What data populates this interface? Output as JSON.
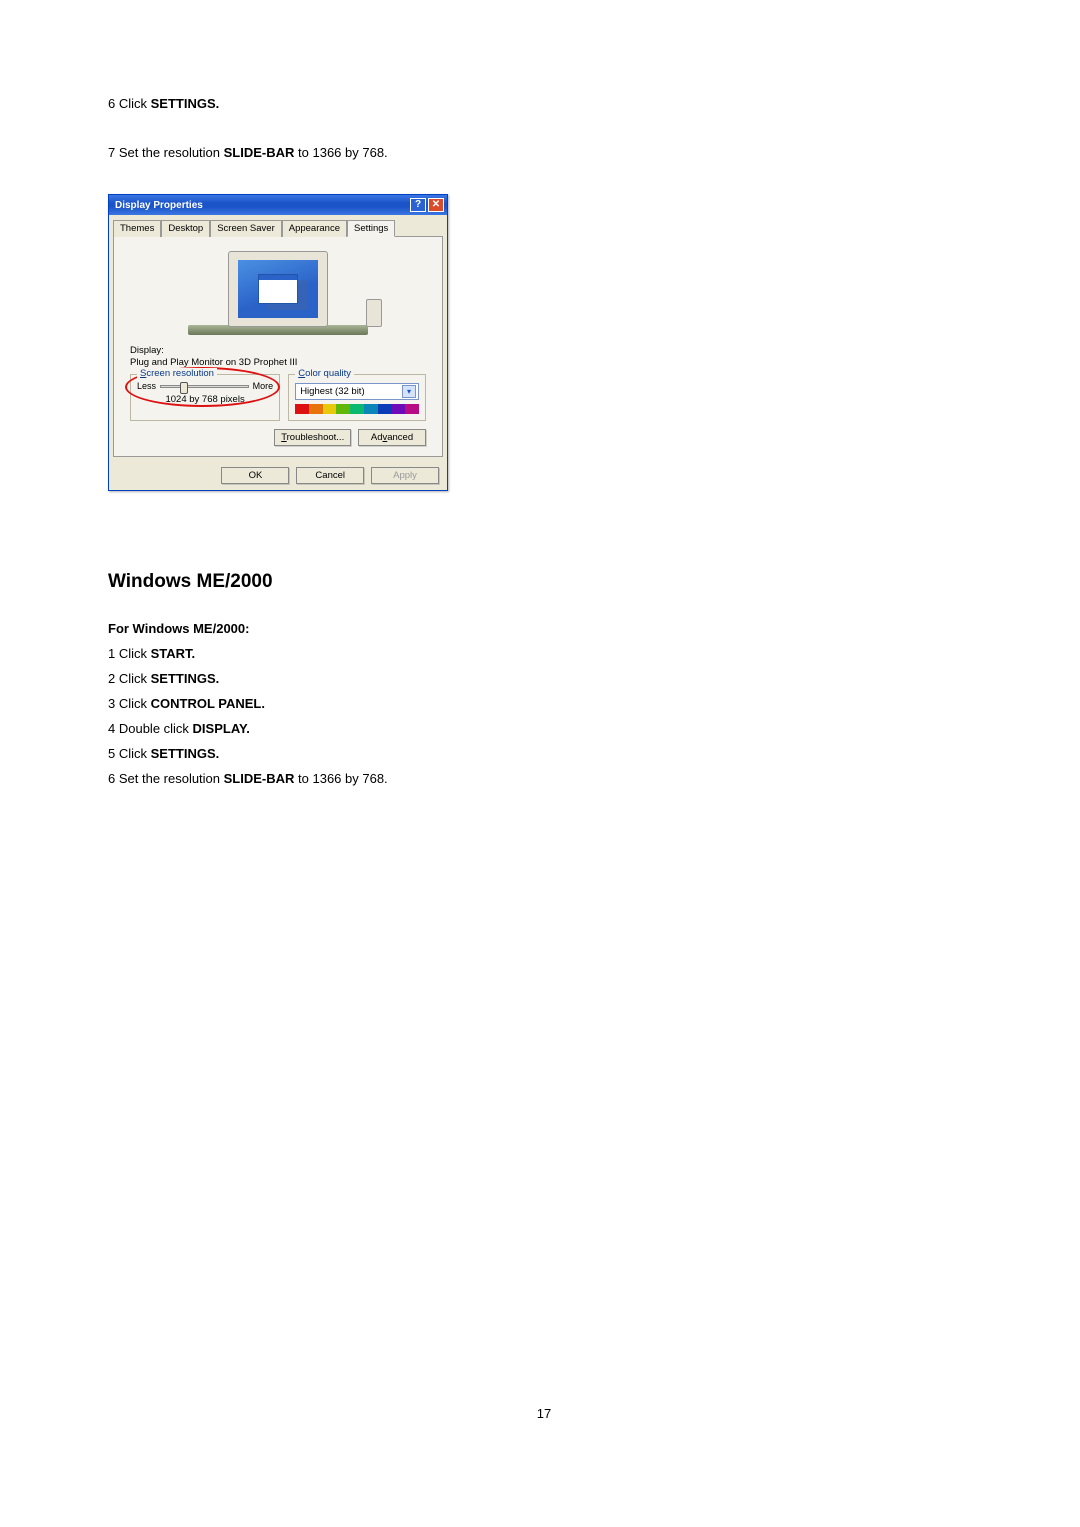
{
  "steps_top": [
    {
      "num": "6",
      "prefix": " Click ",
      "bold": "SETTINGS.",
      "suffix": ""
    },
    {
      "num": "7",
      "prefix": " Set the resolution ",
      "bold": "SLIDE-BAR",
      "suffix": " to 1366 by 768."
    }
  ],
  "dialog": {
    "title": "Display Properties",
    "tabs": [
      "Themes",
      "Desktop",
      "Screen Saver",
      "Appearance",
      "Settings"
    ],
    "active_tab": 4,
    "display_label": "Display:",
    "display_text": "Plug and Play Monitor on 3D Prophet III",
    "screen_res": {
      "legend": "Screen resolution",
      "less": "Less",
      "more": "More",
      "value": "1024 by 768 pixels"
    },
    "color_quality": {
      "legend": "Color quality",
      "value": "Highest (32 bit)"
    },
    "buttons": {
      "troubleshoot": "Troubleshoot...",
      "advanced": "Advanced",
      "ok": "OK",
      "cancel": "Cancel",
      "apply": "Apply"
    }
  },
  "section_heading": "Windows ME/2000",
  "section_sub": "For Windows ME/2000:",
  "steps_bottom": [
    {
      "num": "1",
      "prefix": " Click ",
      "bold": "START.",
      "suffix": ""
    },
    {
      "num": "2",
      "prefix": " Click ",
      "bold": "SETTINGS.",
      "suffix": ""
    },
    {
      "num": "3",
      "prefix": " Click ",
      "bold": "CONTROL PANEL.",
      "suffix": ""
    },
    {
      "num": "4",
      "prefix": " Double click ",
      "bold": "DISPLAY.",
      "suffix": ""
    },
    {
      "num": "5",
      "prefix": " Click ",
      "bold": "SETTINGS.",
      "suffix": ""
    },
    {
      "num": "6",
      "prefix": " Set the resolution ",
      "bold": "SLIDE-BAR",
      "suffix": " to 1366 by 768."
    }
  ],
  "page_number": "17"
}
